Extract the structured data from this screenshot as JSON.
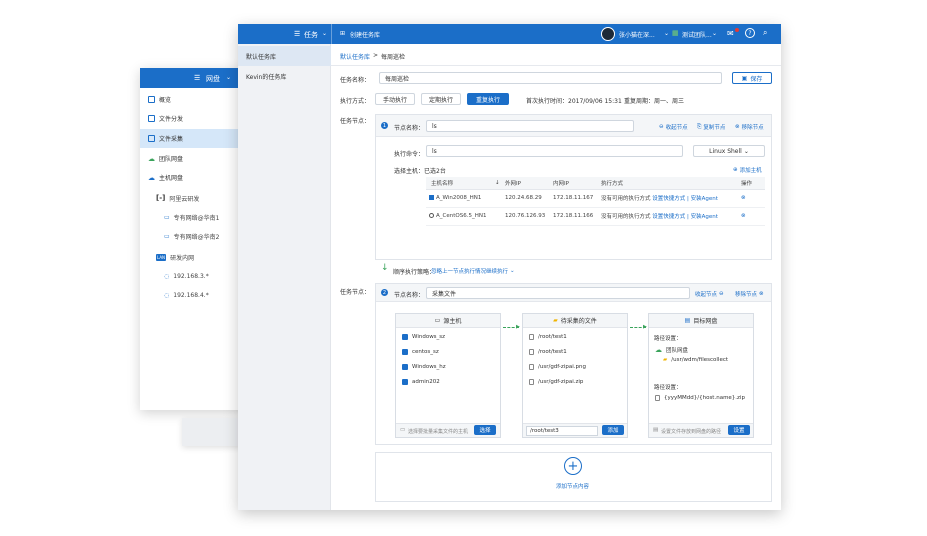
{
  "back_window": {
    "header_title": "网盘",
    "nav": [
      {
        "label": "概览",
        "icon": "overview-icon"
      },
      {
        "label": "文件分发",
        "icon": "distribute-icon"
      },
      {
        "label": "文件采集",
        "icon": "collect-icon"
      },
      {
        "label": "团队网盘",
        "icon": "cloud-icon"
      },
      {
        "label": "主机网盘",
        "icon": "cloud-icon"
      }
    ],
    "cloud_group": "阿里云研发",
    "cloud_subs": [
      "专有网络@华南1",
      "专有网络@华南2"
    ],
    "lan_badge": "LAN",
    "lan_group": "研发内网",
    "lan_subs": [
      "192.168.3.*",
      "192.168.4.*"
    ]
  },
  "top_bar": {
    "menu_title": "任务",
    "create_task": "创建任务库",
    "user_name": "张小猫在深...",
    "team_name": "测试团队...",
    "mail_dot_color": "#e53935"
  },
  "left_panel": {
    "items": [
      "默认任务库",
      "Kevin的任务库"
    ]
  },
  "breadcrumb": {
    "root": "默认任务库",
    "sep": ">",
    "current": "每周巡检"
  },
  "form": {
    "name_label": "任务名称：",
    "name_value": "每周巡检",
    "save_label": "保存",
    "mode_label": "执行方式：",
    "modes": [
      "手动执行",
      "定期执行",
      "重复执行"
    ],
    "first_exec": "首次执行时间：2017/09/06  15:31",
    "repeat_cycle": "重复周期：周一、周三",
    "node_label": "任务节点："
  },
  "node1": {
    "badge": "1",
    "name_label": "节点名称：",
    "name_value": "ls",
    "collapse": "收起节点",
    "copy": "复制节点",
    "remove": "移除节点",
    "cmd_label": "执行命令：",
    "cmd_value": "ls",
    "shell": "Linux Shell",
    "host_label": "选择主机：已选2台",
    "add_host": "添加主机",
    "table": {
      "headers": [
        "主机名称",
        "↓",
        "外网IP",
        "内网IP",
        "执行方式",
        "操作"
      ],
      "rows": [
        {
          "name": "A_Win2008_HN1",
          "public_ip": "120.24.68.29",
          "private_ip": "172.18.11.167",
          "mode": "没有可用的执行方式",
          "action": "设置快捷方式 | 安装Agent"
        },
        {
          "name": "A_CentOS6.5_HN1",
          "public_ip": "120.76.126.93",
          "private_ip": "172.18.11.166",
          "mode": "没有可用的执行方式",
          "action": "设置快捷方式 | 安装Agent"
        }
      ]
    }
  },
  "strategy": {
    "label": "顺序执行策略：",
    "value": "忽略上一节点执行情况继续执行"
  },
  "node2": {
    "section_label": "任务节点：",
    "badge": "2",
    "name_label": "节点名称：",
    "name_value": "采集文件",
    "collapse": "收起节点",
    "remove": "移除节点",
    "source": {
      "title": "源主机",
      "hosts": [
        "Windows_sz",
        "centos_sz",
        "Windows_hz",
        "admin202"
      ],
      "footer_placeholder": "选择要批量采集文件的主机",
      "footer_button": "选择"
    },
    "files": {
      "title": "待采集的文件",
      "items": [
        "/root/test1",
        "/root/test1",
        "/usr/gdf-zipai.png",
        "/usr/gdf-zipai.zip"
      ],
      "footer_value": "/root/test3",
      "footer_button": "添加"
    },
    "target": {
      "title": "目标网盘",
      "path_label": "路径设置：",
      "drive": "团队网盘",
      "path": "/usr/wdm/filescollect",
      "name_label": "路径设置：",
      "name_value": "{yyyMMdd}/{host.name}.zip",
      "footer_placeholder": "设置文件存放到网盘的路径",
      "footer_button": "设置"
    }
  },
  "add_node": {
    "label": "添加节点内容"
  },
  "colors": {
    "primary": "#1b6ec8",
    "sidebar_active": "#d5e7f9",
    "flow_arrow": "#3aa35b"
  }
}
